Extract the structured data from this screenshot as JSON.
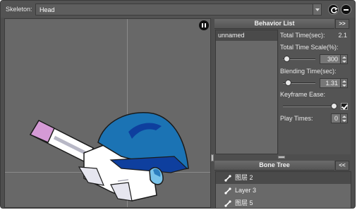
{
  "toolbar": {
    "skeleton_label": "Skeleton:",
    "skeleton_value": "Head",
    "refresh_icon": "refresh-icon",
    "stop_icon": "minus-circle-icon"
  },
  "viewport": {
    "pause_icon": "pause-icon"
  },
  "behavior_panel": {
    "title": "Behavior List",
    "toggle_label": ">>",
    "items": [
      {
        "label": "unnamed",
        "selected": true
      }
    ],
    "properties": {
      "total_time_label": "Total Time(sec):",
      "total_time_value": "2.1",
      "time_scale_label": "Total Time Scale(%):",
      "time_scale_value": "300",
      "blending_time_label": "Blending Time(sec):",
      "blending_time_value": "1.31",
      "keyframe_ease_label": "Keyframe Ease:",
      "keyframe_ease_checked": true,
      "play_times_label": "Play Times:",
      "play_times_value": "0"
    }
  },
  "bone_tree": {
    "title": "Bone Tree",
    "toggle_label": "<<",
    "items": [
      {
        "label": "图层 2",
        "selected": true
      },
      {
        "label": "Layer 3",
        "selected": false
      },
      {
        "label": "图层 5",
        "selected": false
      }
    ]
  },
  "colors": {
    "panel_bg": "#4e4e4e",
    "viewport_bg": "#686868",
    "helmet_blue": "#1b73b4",
    "helmet_stripe": "#0e3f9e",
    "accent_pink": "#d59ad6"
  }
}
